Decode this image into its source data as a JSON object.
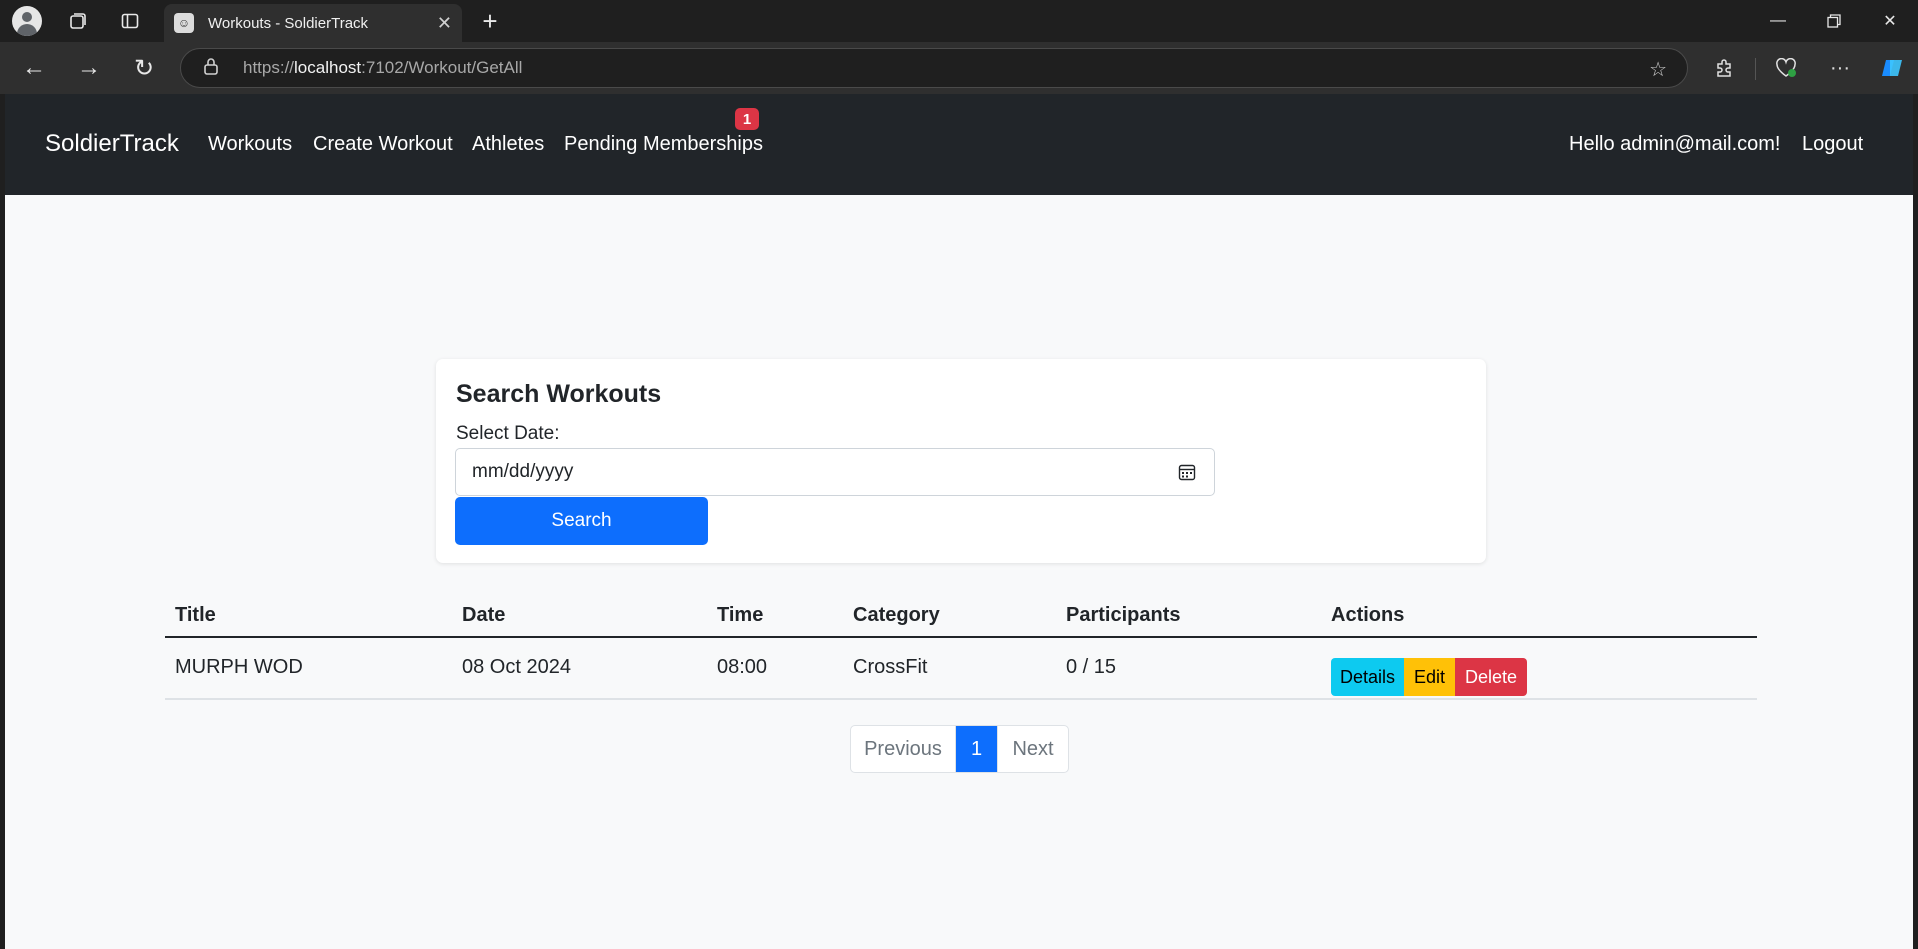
{
  "browser": {
    "tab_title": "Workouts - SoldierTrack",
    "favicon": "soldier-favicon",
    "url_prefix": "https://",
    "url_host": "localhost",
    "url_rest": ":7102/Workout/GetAll"
  },
  "navbar": {
    "brand": "SoldierTrack",
    "links": [
      "Workouts",
      "Create Workout",
      "Athletes",
      "Pending Memberships"
    ],
    "pending_badge": "1",
    "greeting": "Hello admin@mail.com!",
    "logout": "Logout"
  },
  "search": {
    "title": "Search Workouts",
    "date_label": "Select Date:",
    "date_placeholder": "mm/dd/yyyy",
    "button": "Search"
  },
  "table": {
    "headers": [
      "Title",
      "Date",
      "Time",
      "Category",
      "Participants",
      "Actions"
    ],
    "rows": [
      {
        "title": "MURPH WOD",
        "date": "08 Oct 2024",
        "time": "08:00",
        "category": "CrossFit",
        "participants": "0 / 15",
        "actions": [
          "Details",
          "Edit",
          "Delete"
        ]
      }
    ]
  },
  "pagination": {
    "previous": "Previous",
    "current": "1",
    "next": "Next"
  },
  "colors": {
    "primary": "#0d6efd",
    "info": "#0dcaf0",
    "warning": "#ffc107",
    "danger": "#dc3545",
    "navbar": "#212529"
  }
}
